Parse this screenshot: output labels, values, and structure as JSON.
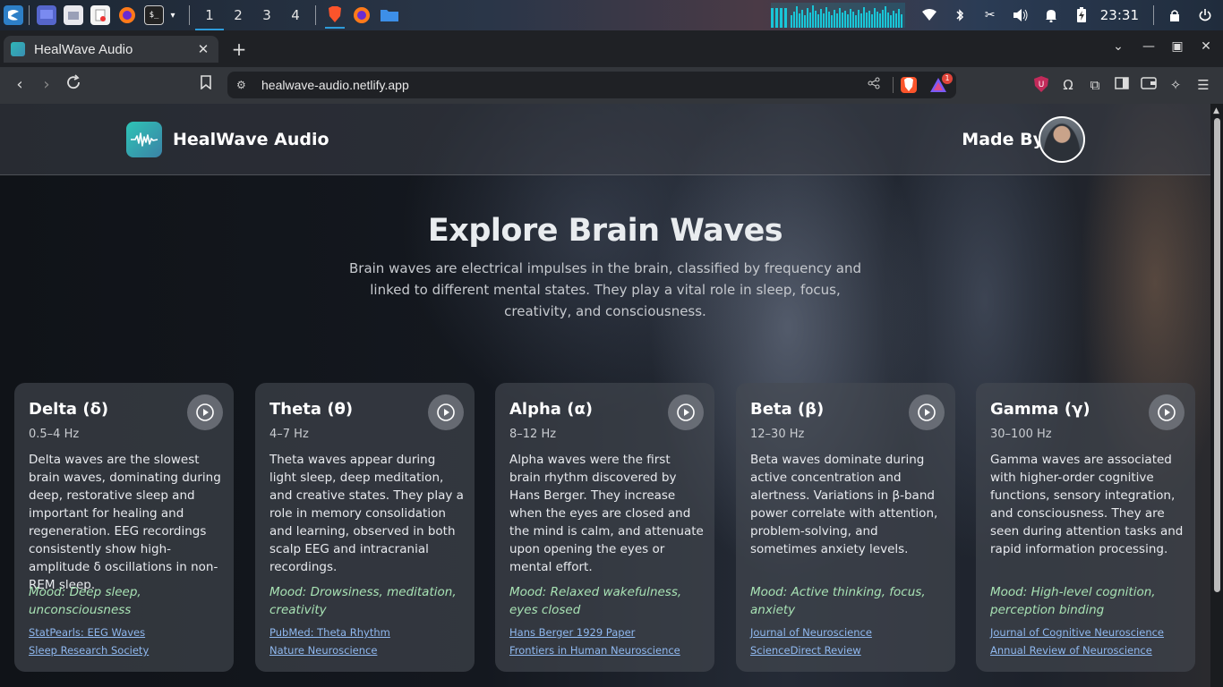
{
  "taskbar": {
    "workspaces": [
      "1",
      "2",
      "3",
      "4"
    ],
    "clock": "23:31",
    "icons": [
      "kde-menu-icon",
      "desktop-icon",
      "file-manager-icon",
      "text-editor-icon",
      "firefox-icon",
      "terminal-icon",
      "brave-icon",
      "firefox-icon",
      "folder-icon"
    ],
    "tray_icons": [
      "wifi-icon",
      "bluetooth-icon",
      "tools-icon",
      "volume-icon",
      "bell-icon",
      "battery-icon",
      "lock-icon",
      "power-icon"
    ]
  },
  "browser": {
    "tab_title": "HealWave Audio",
    "url": "healwave-audio.netlify.app",
    "rewards_badge": "1",
    "accent": "#fb542b"
  },
  "site": {
    "title": "HealWave Audio",
    "made_by": "Made By",
    "hero_title": "Explore Brain Waves",
    "hero_desc": "Brain waves are electrical impulses in the brain, classified by frequency and linked to different mental states. They play a vital role in sleep, focus, creativity, and consciousness."
  },
  "cards": [
    {
      "title": "Delta (δ)",
      "hz": "0.5–4 Hz",
      "desc": "Delta waves are the slowest brain waves, dominating during deep, restorative sleep and important for healing and regeneration. EEG recordings consistently show high-amplitude δ oscillations in non-REM sleep.",
      "mood": "Mood: Deep sleep, unconsciousness",
      "links": [
        "StatPearls: EEG Waves",
        "Sleep Research Society"
      ]
    },
    {
      "title": "Theta (θ)",
      "hz": "4–7 Hz",
      "desc": "Theta waves appear during light sleep, deep meditation, and creative states. They play a role in memory consolidation and learning, observed in both scalp EEG and intracranial recordings.",
      "mood": "Mood: Drowsiness, meditation, creativity",
      "links": [
        "PubMed: Theta Rhythm",
        "Nature Neuroscience"
      ]
    },
    {
      "title": "Alpha (α)",
      "hz": "8–12 Hz",
      "desc": "Alpha waves were the first brain rhythm discovered by Hans Berger. They increase when the eyes are closed and the mind is calm, and attenuate upon opening the eyes or mental effort.",
      "mood": "Mood: Relaxed wakefulness, eyes closed",
      "links": [
        "Hans Berger 1929 Paper",
        "Frontiers in Human Neuroscience"
      ]
    },
    {
      "title": "Beta (β)",
      "hz": "12–30 Hz",
      "desc": "Beta waves dominate during active concentration and alertness. Variations in β-band power correlate with attention, problem-solving, and sometimes anxiety levels.",
      "mood": "Mood: Active thinking, focus, anxiety",
      "links": [
        "Journal of Neuroscience",
        "ScienceDirect Review"
      ]
    },
    {
      "title": "Gamma (γ)",
      "hz": "30–100 Hz",
      "desc": "Gamma waves are associated with higher-order cognitive functions, sensory integration, and consciousness. They are seen during attention tasks and rapid information processing.",
      "mood": "Mood: High-level cognition, perception binding",
      "links": [
        "Journal of Cognitive Neuroscience",
        "Annual Review of Neuroscience"
      ]
    }
  ]
}
